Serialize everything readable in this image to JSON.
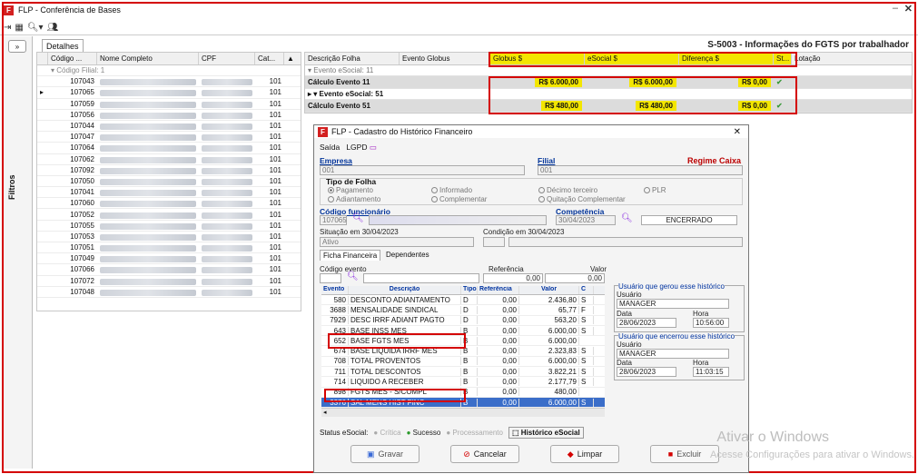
{
  "window": {
    "title": "FLP - Conferência de Bases",
    "min": "–",
    "close": "✕"
  },
  "sidebar": {
    "label": "Filtros",
    "expand": "»"
  },
  "tab": {
    "detalhes": "Detalhes"
  },
  "header_title": "S-5003 - Informações do FGTS por trabalhador",
  "left_grid": {
    "columns": [
      "Código ...",
      "Nome Completo",
      "CPF",
      "Cat..."
    ],
    "group": "Código Filial: 1",
    "rows": [
      {
        "code": "107043",
        "cat": "101"
      },
      {
        "code": "107065",
        "cat": "101"
      },
      {
        "code": "107059",
        "cat": "101"
      },
      {
        "code": "107056",
        "cat": "101"
      },
      {
        "code": "107044",
        "cat": "101"
      },
      {
        "code": "107047",
        "cat": "101"
      },
      {
        "code": "107064",
        "cat": "101"
      },
      {
        "code": "107062",
        "cat": "101"
      },
      {
        "code": "107092",
        "cat": "101"
      },
      {
        "code": "107050",
        "cat": "101"
      },
      {
        "code": "107041",
        "cat": "101"
      },
      {
        "code": "107060",
        "cat": "101"
      },
      {
        "code": "107052",
        "cat": "101"
      },
      {
        "code": "107055",
        "cat": "101"
      },
      {
        "code": "107053",
        "cat": "101"
      },
      {
        "code": "107051",
        "cat": "101"
      },
      {
        "code": "107049",
        "cat": "101"
      },
      {
        "code": "107066",
        "cat": "101"
      },
      {
        "code": "107072",
        "cat": "101"
      },
      {
        "code": "107048",
        "cat": "101"
      }
    ]
  },
  "right_grid": {
    "columns": [
      "Descrição Folha",
      "Evento Globus",
      "Globus $",
      "eSocial $",
      "Diferença $",
      "St...",
      "Lotação"
    ],
    "group1": "Evento eSocial: 11",
    "row1": {
      "desc": "Cálculo Evento 11",
      "globus": "R$ 6.000,00",
      "esocial": "R$ 6.000,00",
      "dif": "R$ 0,00"
    },
    "group2": "Evento eSocial: 51",
    "row2": {
      "desc": "Cálculo Evento 51",
      "globus": "R$ 480,00",
      "esocial": "R$ 480,00",
      "dif": "R$ 0,00"
    }
  },
  "dialog": {
    "title": "FLP - Cadastro do Histórico Financeiro",
    "menu_saida": "Saída",
    "menu_lgpd": "LGPD",
    "empresa_label": "Empresa",
    "empresa_value": "001",
    "filial_label": "Filial",
    "filial_value": "001",
    "regime_label": "Regime Caixa",
    "tipo_folha_label": "Tipo de Folha",
    "radio_pagamento": "Pagamento",
    "radio_informado": "Informado",
    "radio_decimo": "Décimo terceiro",
    "radio_plr": "PLR",
    "radio_adiantamento": "Adiantamento",
    "radio_complementar": "Complementar",
    "radio_quitacao": "Quitação Complementar",
    "cod_func_label": "Código funcionário",
    "cod_func_value": "107065",
    "competencia_label": "Competência",
    "competencia_value": "30/04/2023",
    "status_competencia": "ENCERRADO",
    "situacao_label": "Situação em 30/04/2023",
    "situacao_value": "Ativo",
    "condicao_label": "Condição em 30/04/2023",
    "tab_ficha": "Ficha Financeira",
    "tab_dependentes": "Dependentes",
    "cod_evento_label": "Código evento",
    "referencia_label": "Referência",
    "valor_label": "Valor",
    "referencia_value": "0,00",
    "valor_value": "0,00",
    "events_columns": [
      "Evento",
      "Descrição",
      "Tipo",
      "Referência",
      "Valor",
      "C"
    ],
    "events": [
      {
        "ev": "580",
        "desc": "DESCONTO ADIANTAMENTO",
        "tipo": "D",
        "ref": "0,00",
        "val": "2.436,80",
        "c": "S"
      },
      {
        "ev": "3688",
        "desc": "MENSALIDADE SINDICAL",
        "tipo": "D",
        "ref": "0,00",
        "val": "65,77",
        "c": "F"
      },
      {
        "ev": "7929",
        "desc": "DESC IRRF ADIANT PAGTO",
        "tipo": "D",
        "ref": "0,00",
        "val": "563,20",
        "c": "S"
      },
      {
        "ev": "643",
        "desc": "BASE INSS MES",
        "tipo": "B",
        "ref": "0,00",
        "val": "6.000,00",
        "c": "S"
      },
      {
        "ev": "652",
        "desc": "BASE FGTS MES",
        "tipo": "B",
        "ref": "0,00",
        "val": "6.000,00",
        "c": ""
      },
      {
        "ev": "674",
        "desc": "BASE LIQUIDA IRRF MES",
        "tipo": "B",
        "ref": "0,00",
        "val": "2.323,83",
        "c": "S"
      },
      {
        "ev": "708",
        "desc": "TOTAL PROVENTOS",
        "tipo": "B",
        "ref": "0,00",
        "val": "6.000,00",
        "c": "S"
      },
      {
        "ev": "711",
        "desc": "TOTAL DESCONTOS",
        "tipo": "B",
        "ref": "0,00",
        "val": "3.822,21",
        "c": "S"
      },
      {
        "ev": "714",
        "desc": "LIQUIDO A RECEBER",
        "tipo": "B",
        "ref": "0,00",
        "val": "2.177,79",
        "c": "S"
      },
      {
        "ev": "898",
        "desc": "FGTS MES - S/COMPL",
        "tipo": "B",
        "ref": "0,00",
        "val": "480,00",
        "c": ""
      },
      {
        "ev": "3376",
        "desc": "SAL MENS HIST FINC",
        "tipo": "B",
        "ref": "0,00",
        "val": "6.000,00",
        "c": "S"
      }
    ],
    "gerou_title": "Usuário que gerou esse histórico",
    "encerrou_title": "Usuário que encerrou esse histórico",
    "usuario_label": "Usuário",
    "usuario_value": "MANAGER",
    "data_label": "Data",
    "hora_label": "Hora",
    "gerou_data": "28/06/2023",
    "gerou_hora": "10:56:00",
    "encerrou_data": "28/06/2023",
    "encerrou_hora": "11:03:15",
    "status_label": "Status eSocial:",
    "status_critica": "Crítica",
    "status_sucesso": "Sucesso",
    "status_processamento": "Processamento",
    "historico_esocial": "Histórico eSocial",
    "btn_gravar": "Gravar",
    "btn_cancelar": "Cancelar",
    "btn_limpar": "Limpar",
    "btn_excluir": "Excluir"
  },
  "watermark": {
    "line1": "Ativar o Windows",
    "line2": "Acesse Configurações para ativar o Windows."
  }
}
